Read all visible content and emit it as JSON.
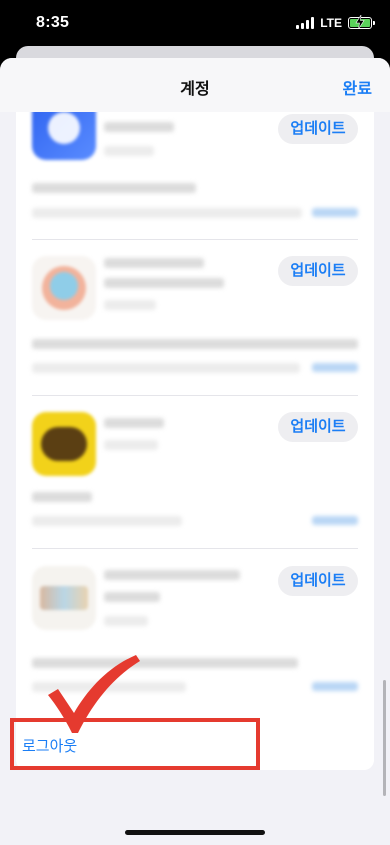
{
  "status_bar": {
    "time": "8:35",
    "network": "LTE",
    "battery_charging": true
  },
  "nav": {
    "title": "계정",
    "done_label": "완료"
  },
  "apps": [
    {
      "update_label": "업데이트",
      "icon": "blurred-app-icon-blue"
    },
    {
      "update_label": "업데이트",
      "icon": "blurred-app-icon-peach"
    },
    {
      "update_label": "업데이트",
      "icon": "blurred-app-icon-yellow"
    },
    {
      "update_label": "업데이트",
      "icon": "blurred-app-icon-beige"
    }
  ],
  "logout": {
    "label": "로그아웃"
  },
  "annotation": {
    "checkmark_color": "#e53a2f",
    "highlight_color": "#e53a2f"
  },
  "colors": {
    "accent": "#1b7ef5",
    "sheet_bg": "#f2f2f7"
  }
}
